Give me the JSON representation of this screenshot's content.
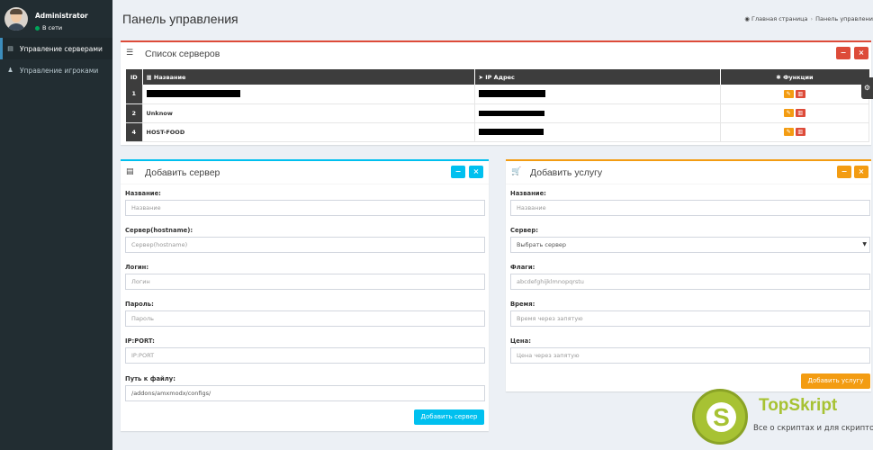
{
  "user": {
    "name": "Administrator",
    "status": "В сети"
  },
  "sidebar": {
    "items": [
      {
        "label": "Управление серверами",
        "icon": "server-icon",
        "active": true
      },
      {
        "label": "Управление игроками",
        "icon": "user-icon",
        "active": false
      }
    ]
  },
  "header": {
    "title": "Панель управления",
    "breadcrumb": [
      "Главная страница",
      "Панель управлени"
    ]
  },
  "servers_box": {
    "title": "Список серверов",
    "columns": {
      "id": "ID",
      "name": "Название",
      "ip": "IP Адрес",
      "functions": "Функции"
    },
    "rows": [
      {
        "id": "1",
        "name": "",
        "ip": ""
      },
      {
        "id": "2",
        "name": "Unknow",
        "ip": ""
      },
      {
        "id": "4",
        "name": "HOST-FOOD",
        "ip": ""
      }
    ]
  },
  "add_server": {
    "title": "Добавить сервер",
    "fields": [
      {
        "label": "Название:",
        "placeholder": "Название",
        "value": ""
      },
      {
        "label": "Сервер(hostname):",
        "placeholder": "Сервер(hostname)",
        "value": ""
      },
      {
        "label": "Логин:",
        "placeholder": "Логин",
        "value": ""
      },
      {
        "label": "Пароль:",
        "placeholder": "Пароль",
        "value": ""
      },
      {
        "label": "IP:PORT:",
        "placeholder": "IP:PORT",
        "value": ""
      },
      {
        "label": "Путь к файлу:",
        "placeholder": "",
        "value": "/addons/amxmodx/configs/"
      }
    ],
    "submit": "Добавить сервер"
  },
  "add_service": {
    "title": "Добавить услугу",
    "fields": [
      {
        "label": "Название:",
        "placeholder": "Название",
        "value": ""
      },
      {
        "label": "Сервер:",
        "select_value": "Выбрать сервер"
      },
      {
        "label": "Флаги:",
        "placeholder": "abcdefghijklmnopqrstu",
        "value": ""
      },
      {
        "label": "Время:",
        "placeholder": "Время через запятую",
        "value": ""
      },
      {
        "label": "Цена:",
        "placeholder": "Цена через запятую",
        "value": ""
      }
    ],
    "submit": "Добавить услугу"
  },
  "watermark": {
    "title": "TopSkript",
    "subtitle": "Все о скриптах и для скриптов...",
    "letter": "S"
  },
  "colors": {
    "blue": "#3c8dbc",
    "aqua": "#00c0ef",
    "orange": "#f39c12",
    "red": "#dd4b39",
    "green": "#00a65a",
    "sidebar": "#222d32"
  }
}
